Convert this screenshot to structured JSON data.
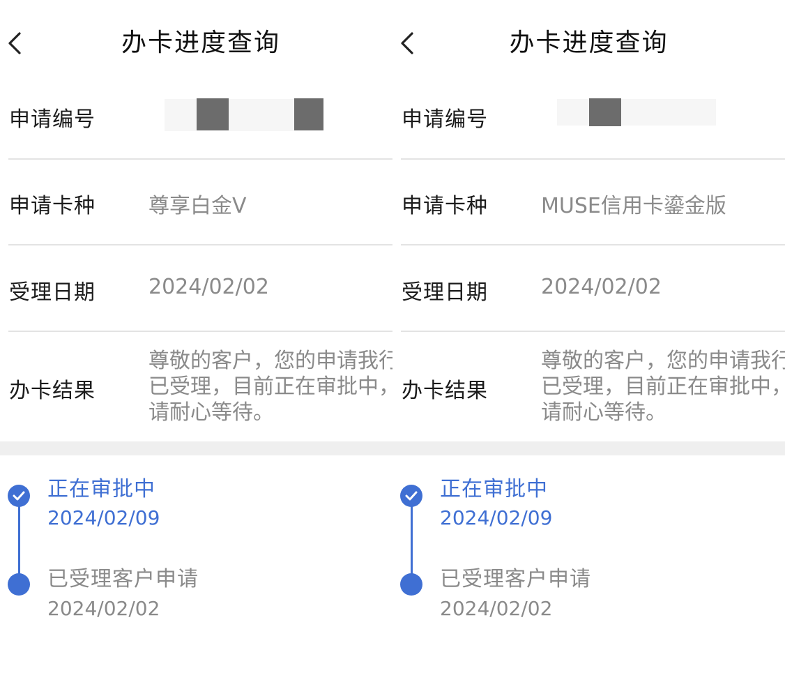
{
  "panels": [
    {
      "header": {
        "title": "办卡进度查询"
      },
      "rows": {
        "app_number_label": "申请编号",
        "card_type_label": "申请卡种",
        "card_type_value": "尊享白金V",
        "date_label": "受理日期",
        "date_value": "2024/02/02",
        "result_label": "办卡结果",
        "result_value": "尊敬的客户，您的申请我行已受理，目前正在审批中，请耐心等待。"
      },
      "timeline": [
        {
          "title": "正在审批中",
          "date": "2024/02/09"
        },
        {
          "title": "已受理客户申请",
          "date": "2024/02/02"
        }
      ]
    },
    {
      "header": {
        "title": "办卡进度查询"
      },
      "rows": {
        "app_number_label": "申请编号",
        "card_type_label": "申请卡种",
        "card_type_value": "MUSE信用卡鎏金版",
        "date_label": "受理日期",
        "date_value": "2024/02/02",
        "result_label": "办卡结果",
        "result_value": "尊敬的客户，您的申请我行已受理，目前正在审批中，请耐心等待。"
      },
      "timeline": [
        {
          "title": "正在审批中",
          "date": "2024/02/09"
        },
        {
          "title": "已受理客户申请",
          "date": "2024/02/02"
        }
      ]
    }
  ],
  "colors": {
    "accent": "#3f6fd3",
    "value_text": "#8a8a8a",
    "divider": "#e3e3e3",
    "band": "#efefef"
  }
}
